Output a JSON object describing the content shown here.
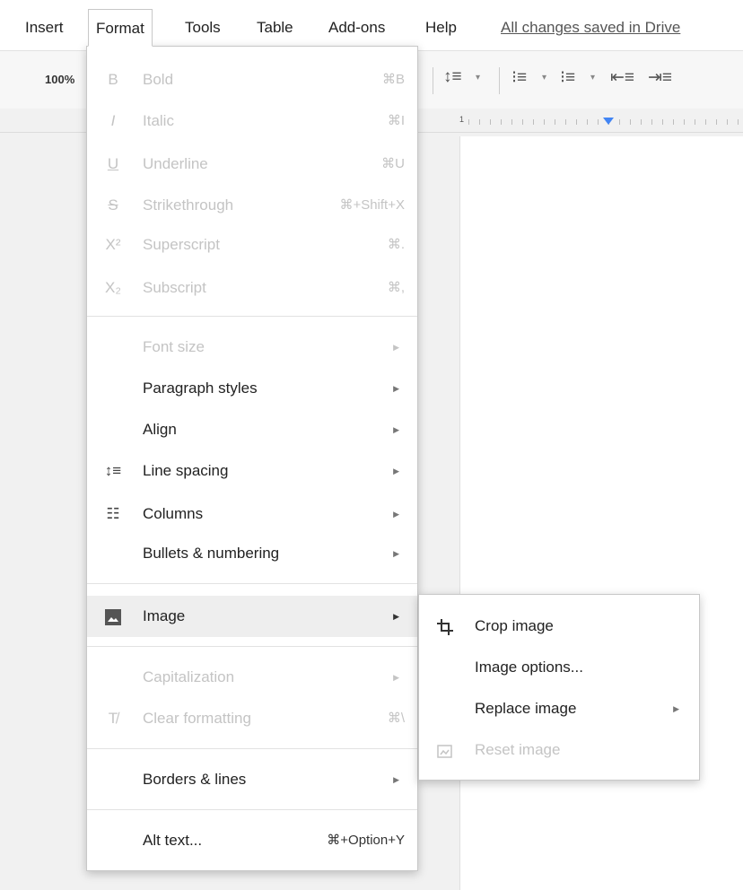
{
  "menubar": {
    "items": [
      "Insert",
      "Format",
      "Tools",
      "Table",
      "Add-ons",
      "Help"
    ],
    "status": "All changes saved in Drive"
  },
  "toolbar": {
    "zoom": "100%",
    "icons": [
      "line-spacing-icon",
      "numbered-list-icon",
      "bulleted-list-icon",
      "decrease-indent-icon",
      "increase-indent-icon"
    ]
  },
  "ruler": {
    "number": "1"
  },
  "format_menu": {
    "items": [
      {
        "icon": "B",
        "label": "Bold",
        "shortcut": "⌘B",
        "disabled": true
      },
      {
        "icon": "I",
        "label": "Italic",
        "shortcut": "⌘I",
        "disabled": true
      },
      {
        "icon": "U",
        "label": "Underline",
        "shortcut": "⌘U",
        "disabled": true
      },
      {
        "icon": "S",
        "label": "Strikethrough",
        "shortcut": "⌘+Shift+X",
        "disabled": true
      },
      {
        "icon": "X²",
        "label": "Superscript",
        "shortcut": "⌘.",
        "disabled": true
      },
      {
        "icon": "X₂",
        "label": "Subscript",
        "shortcut": "⌘,",
        "disabled": true
      },
      {
        "icon": "",
        "label": "Font size",
        "submenu": true,
        "disabled": true
      },
      {
        "icon": "",
        "label": "Paragraph styles",
        "submenu": true
      },
      {
        "icon": "",
        "label": "Align",
        "submenu": true
      },
      {
        "icon": "line-spacing-icon",
        "label": "Line spacing",
        "submenu": true
      },
      {
        "icon": "columns-icon",
        "label": "Columns",
        "submenu": true
      },
      {
        "icon": "",
        "label": "Bullets & numbering",
        "submenu": true
      },
      {
        "icon": "image-icon",
        "label": "Image",
        "submenu": true,
        "highlighted": true
      },
      {
        "icon": "",
        "label": "Capitalization",
        "submenu": true,
        "disabled": true
      },
      {
        "icon": "clear-formatting-icon",
        "label": "Clear formatting",
        "shortcut": "⌘\\",
        "disabled": true
      },
      {
        "icon": "",
        "label": "Borders & lines",
        "submenu": true
      },
      {
        "icon": "",
        "label": "Alt text...",
        "shortcut": "⌘+Option+Y"
      }
    ]
  },
  "image_submenu": {
    "items": [
      {
        "icon": "crop-icon",
        "label": "Crop image"
      },
      {
        "icon": "",
        "label": "Image options..."
      },
      {
        "icon": "",
        "label": "Replace image",
        "submenu": true
      },
      {
        "icon": "reset-image-icon",
        "label": "Reset image",
        "disabled": true
      }
    ]
  },
  "colors": {
    "accent": "#4285f4",
    "disabled_text": "#c4c4c4",
    "highlight": "#eeeeee"
  }
}
